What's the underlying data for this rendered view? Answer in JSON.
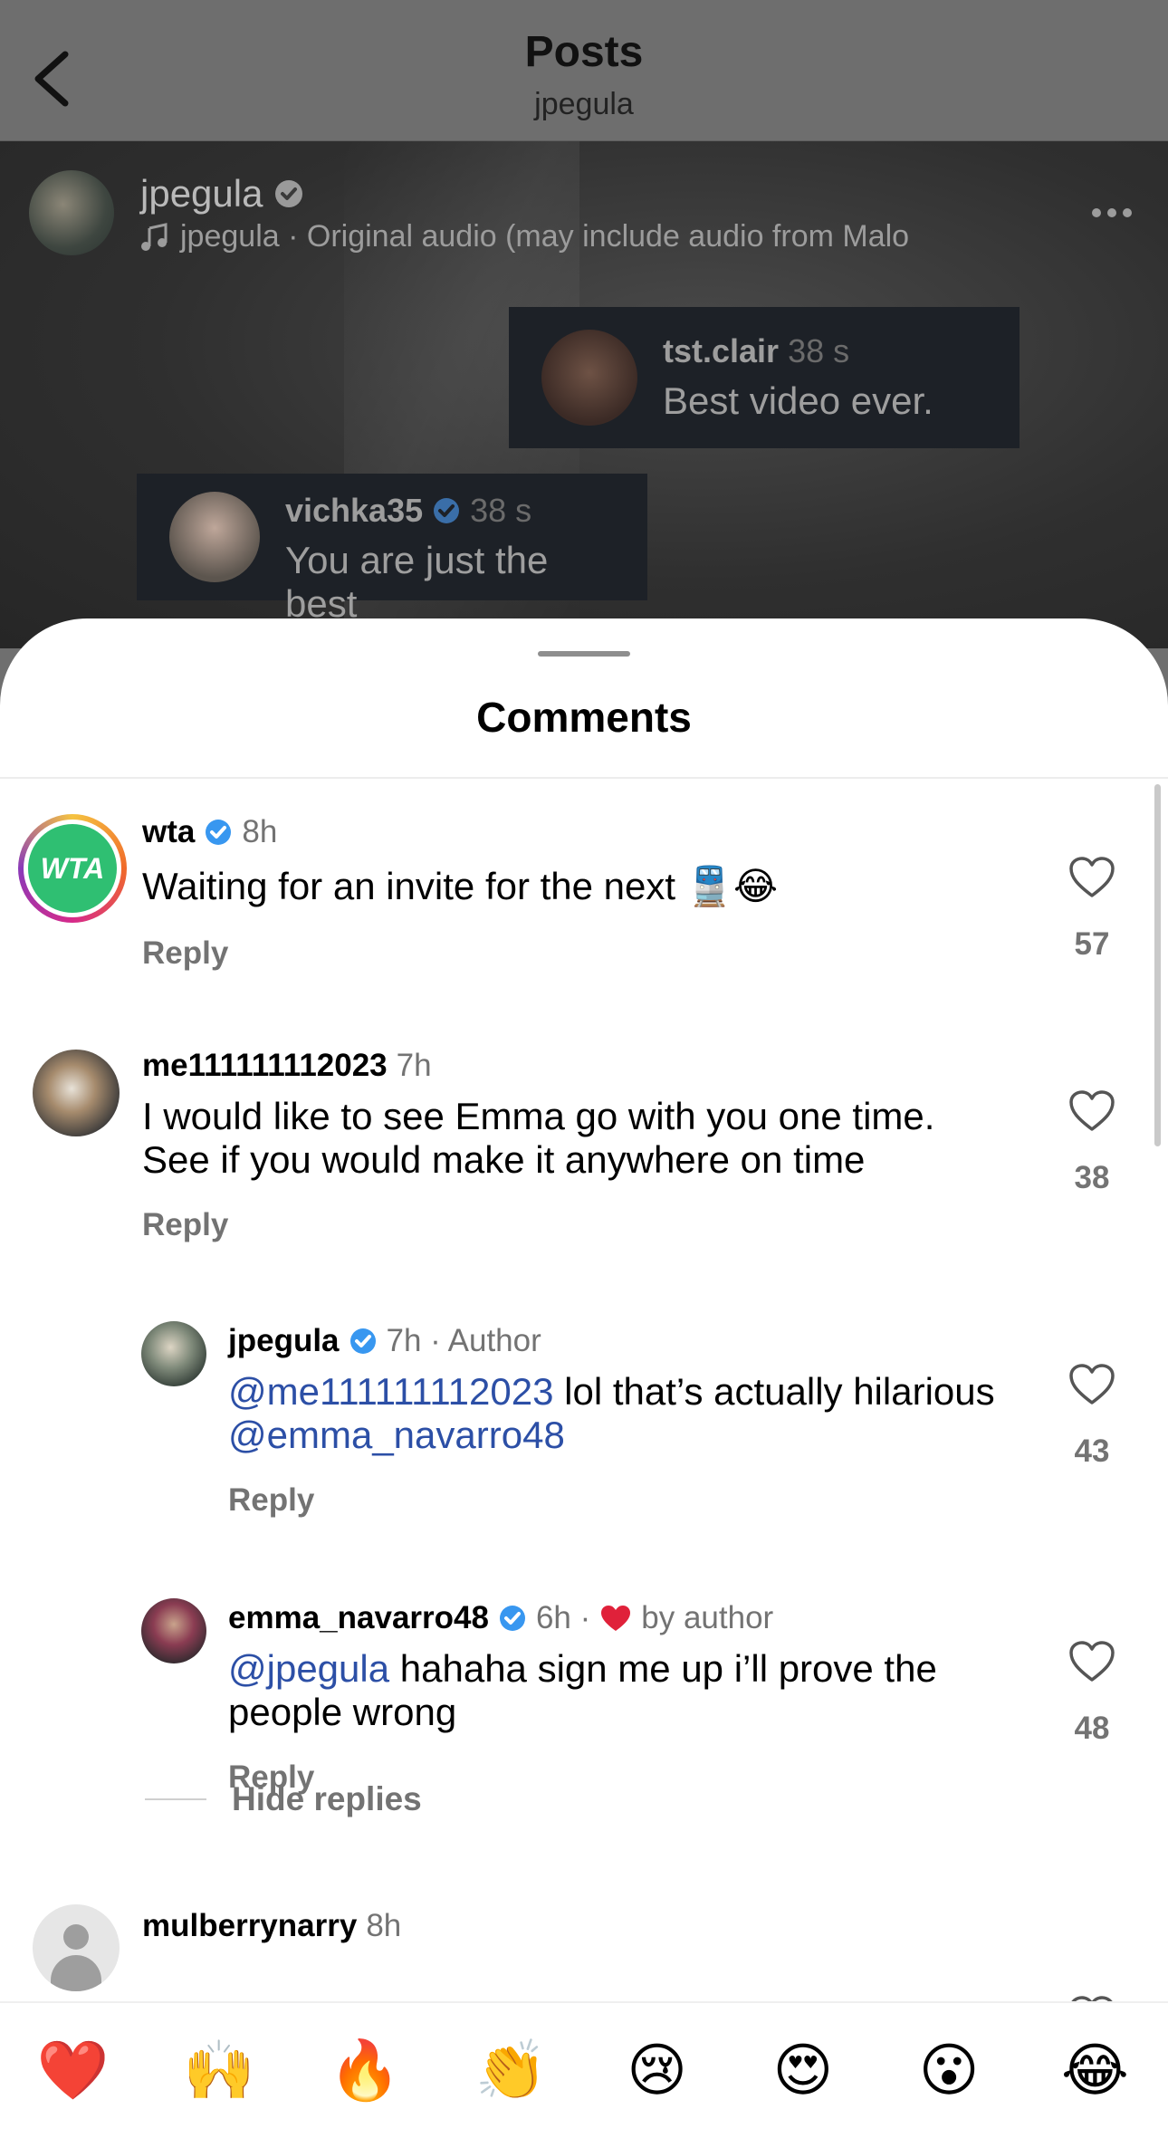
{
  "header": {
    "title": "Posts",
    "subtitle": "jpegula"
  },
  "post": {
    "author": "jpegula",
    "audio": "jpegula · Original audio  (may include audio from Malo ",
    "live_comments": [
      {
        "user": "tst.clair",
        "time": "38 s",
        "text": "Best video ever."
      },
      {
        "user": "vichka35",
        "time": "38 s",
        "text": "You are just the best"
      }
    ]
  },
  "sheet": {
    "title": "Comments"
  },
  "comments": [
    {
      "user": "wta",
      "meta": "8h",
      "text": "Waiting for an invite for the next 🚆😂",
      "avatar_label": "WTA",
      "reply": "Reply",
      "likes": "57"
    },
    {
      "user": "me111111112023",
      "meta": "7h",
      "text": "I would like to see Emma go with you one time. See if you would make it anywhere on time",
      "reply": "Reply",
      "likes": "38"
    },
    {
      "user": "jpegula",
      "meta": "7h · Author",
      "mention1": "@me111111112023",
      "text": " lol that’s actually hilarious",
      "mention2": "@emma_navarro48",
      "reply": "Reply",
      "likes": "43"
    },
    {
      "user": "emma_navarro48",
      "meta_time": "6h ·",
      "meta_by": "by author",
      "mention1": "@jpegula",
      "text": " hahaha sign me up i’ll prove the people wrong",
      "reply": "Reply",
      "likes": "48"
    },
    {
      "user": "mulberrynarry",
      "meta": "8h"
    }
  ],
  "hide_replies": "Hide replies",
  "reactions": [
    "❤️",
    "🙌",
    "🔥",
    "👏",
    "😢",
    "😍",
    "😮",
    "😂"
  ],
  "colors": {
    "verified": "#3897f0",
    "mention": "#2c4fa6",
    "heart_red": "#e0213a",
    "wta_green": "#2fbf72"
  }
}
